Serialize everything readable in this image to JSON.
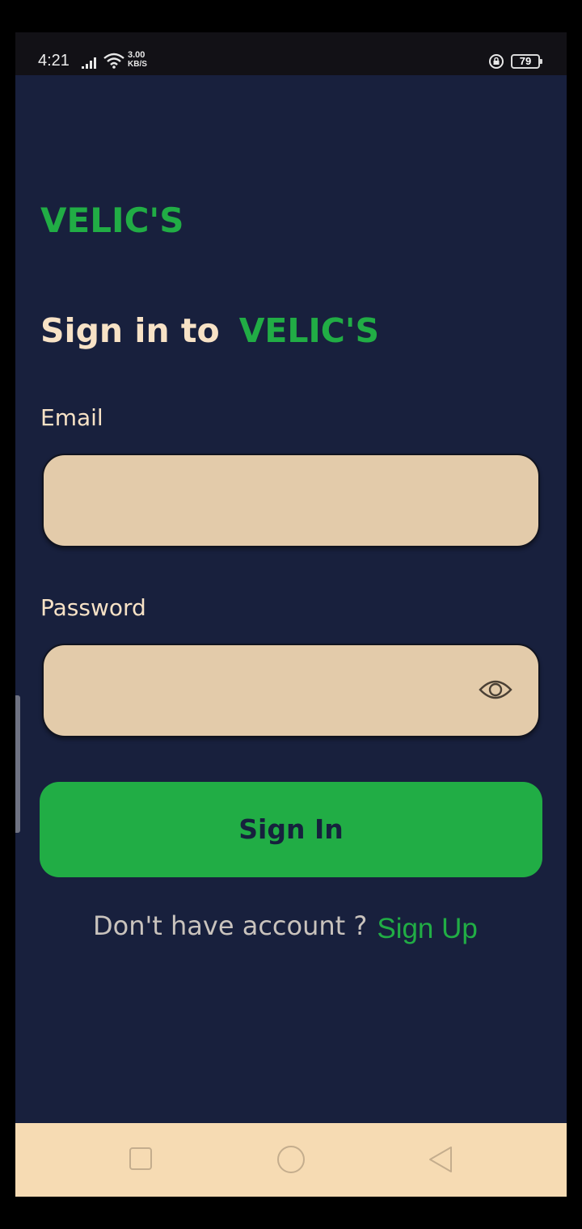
{
  "status_bar": {
    "time": "4:21",
    "net_speed": "3.00",
    "net_unit": "KB/S",
    "battery": "79",
    "icons": [
      "signal-icon",
      "wifi-icon",
      "rotation-lock-icon",
      "battery-icon"
    ]
  },
  "brand": {
    "logo_text": "VELIC'S",
    "accent_color": "#21ad45",
    "background_color": "#18203d"
  },
  "heading": {
    "prefix": "Sign in to",
    "brand": "VELIC'S"
  },
  "form": {
    "email_label": "Email",
    "email_value": "",
    "password_label": "Password",
    "password_value": "",
    "password_toggle_icon": "eye-icon",
    "submit_label": "Sign In"
  },
  "footer": {
    "prompt": "Don't have account ?",
    "signup_link": "Sign Up"
  },
  "nav_bar": {
    "buttons": [
      "recent-apps-icon",
      "home-icon",
      "back-icon"
    ]
  }
}
